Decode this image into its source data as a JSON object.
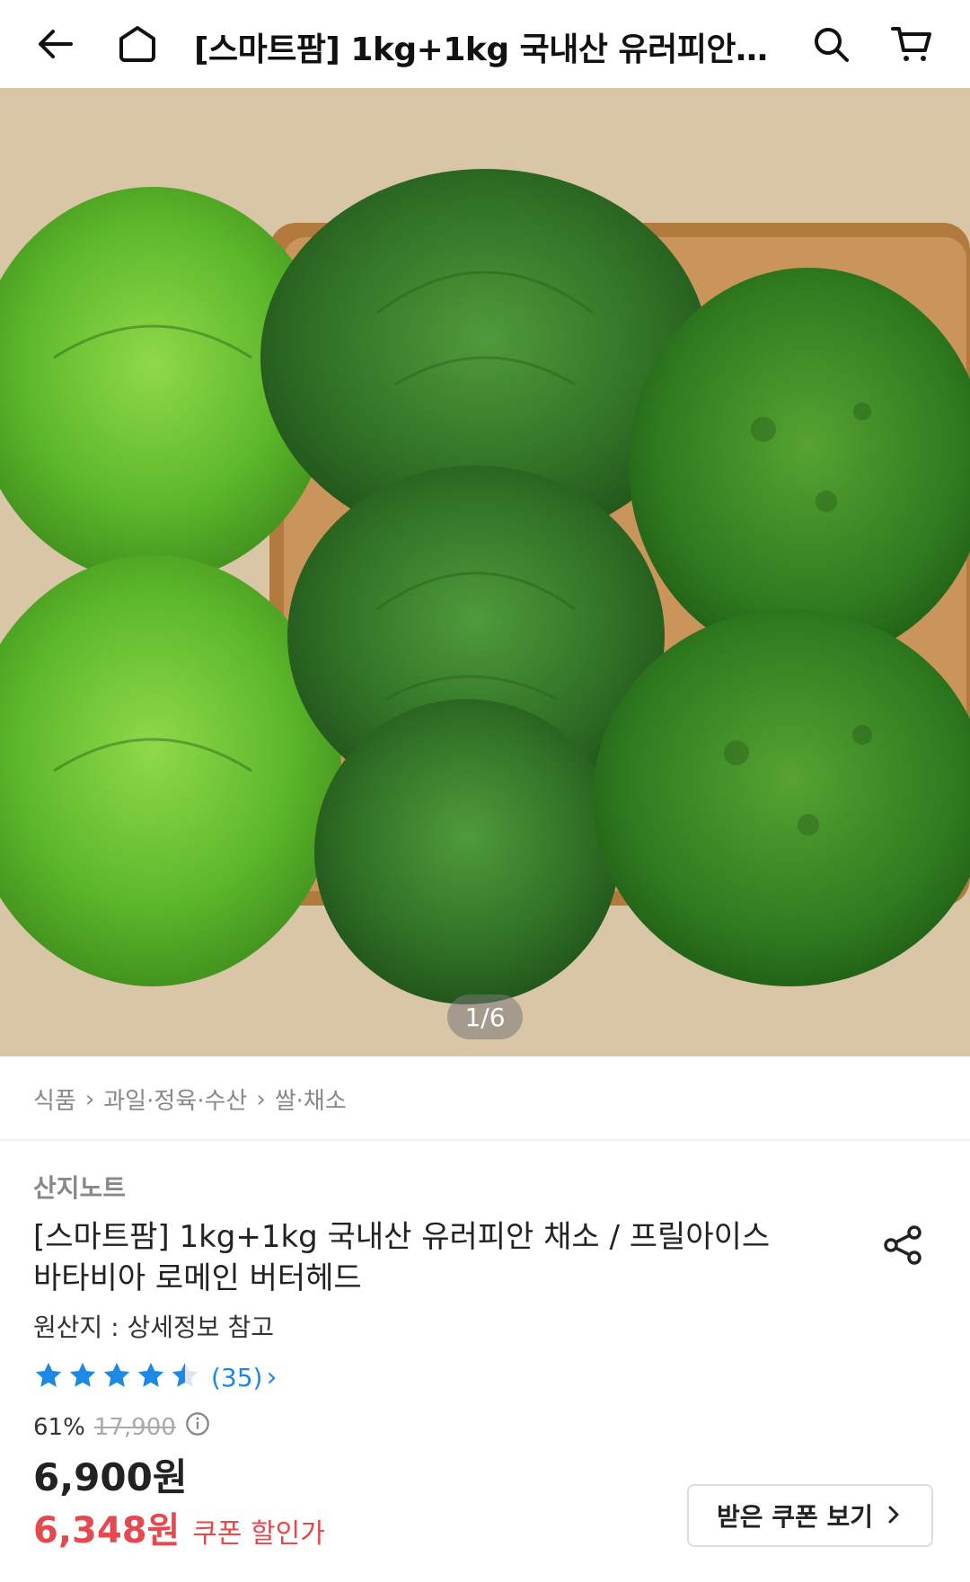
{
  "header": {
    "title": "[스마트팜] 1kg+1kg 국내산 유러피안 채소 / 프릴아이스 바타비아 로메인 버터헤드",
    "back_icon": "arrow-left-icon",
    "home_icon": "home-icon",
    "search_icon": "search-icon",
    "cart_icon": "cart-icon"
  },
  "gallery": {
    "counter": "1/6"
  },
  "breadcrumb": {
    "items": [
      "식품",
      "과일·정육·수산",
      "쌀·채소"
    ]
  },
  "product": {
    "seller": "산지노트",
    "name_line1": "[스마트팜] 1kg+1kg 국내산 유러피안 채소 / 프릴아이스",
    "name_line2": "바타비아 로메인 버터헤드",
    "origin": "원산지 : 상세정보 참고",
    "rating_value": 4.5,
    "review_count": "(35)",
    "discount_pct": "61%",
    "original_price": "17,900",
    "price": "6,900원",
    "coupon_price": "6,348원",
    "coupon_label": "쿠폰 할인가",
    "coupon_button": "받은 쿠폰 보기"
  },
  "colors": {
    "accent_blue": "#1e88e5",
    "sale_red": "#e5484d"
  }
}
